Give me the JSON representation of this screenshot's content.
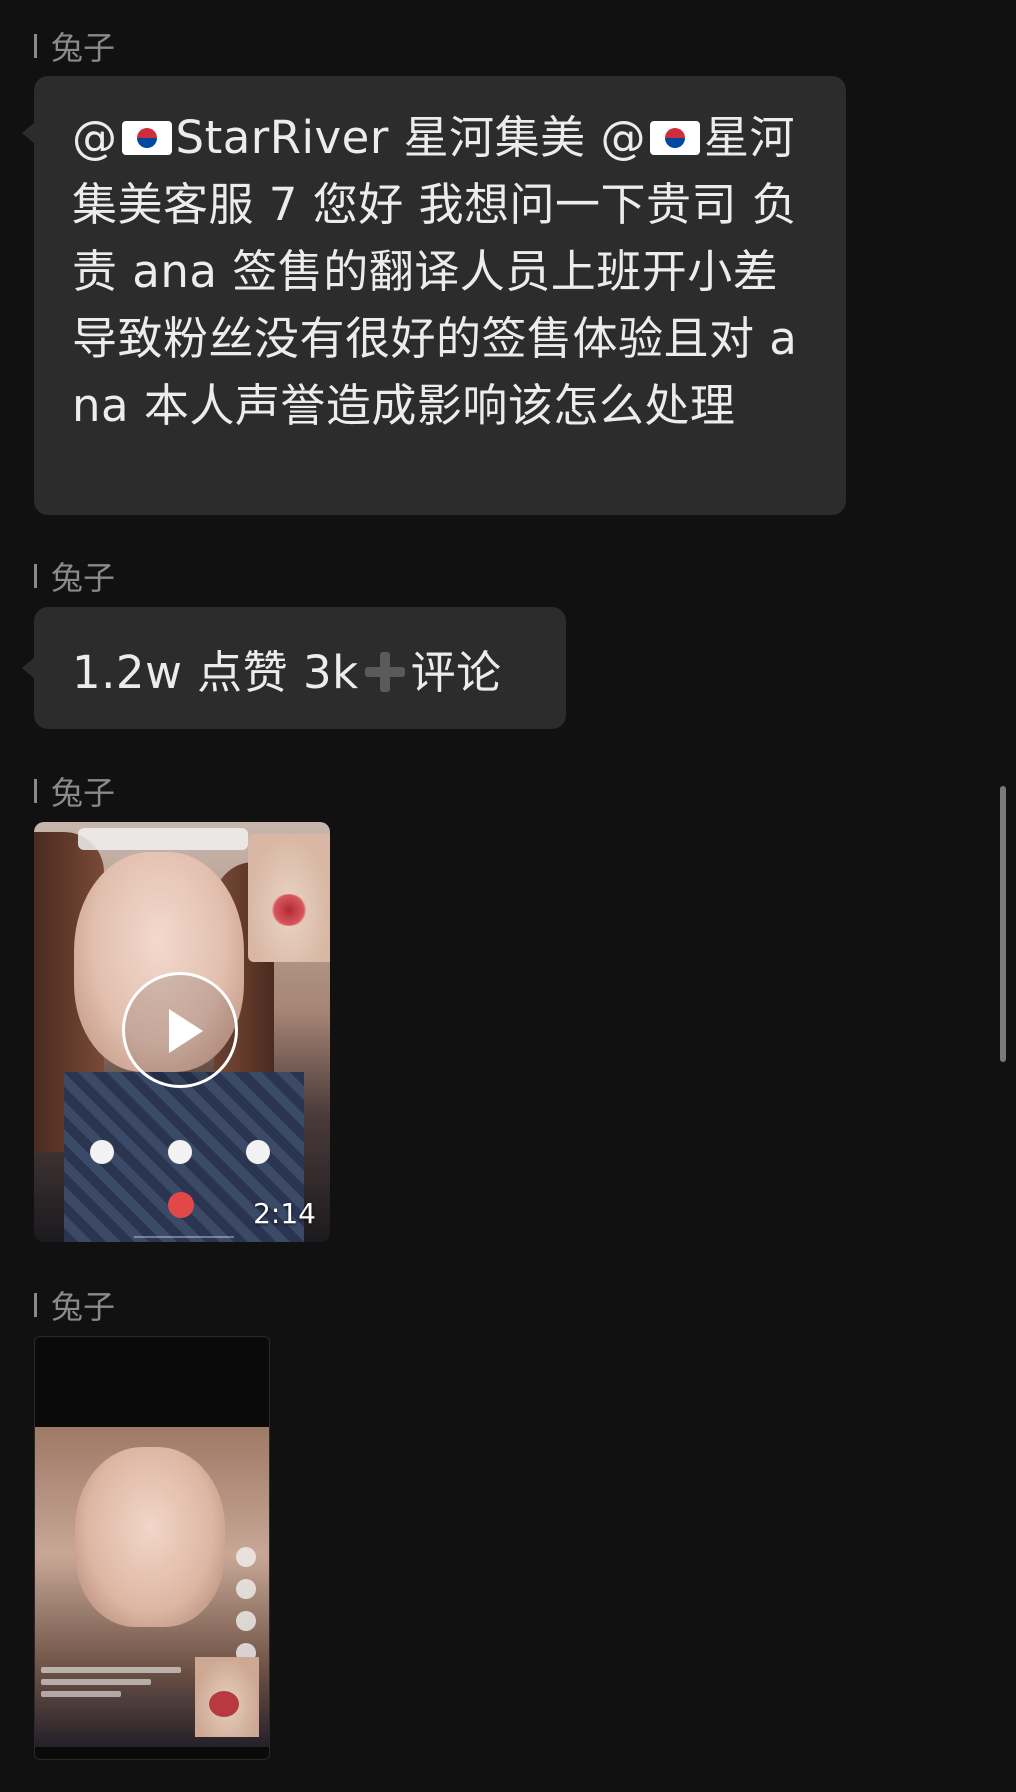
{
  "colors": {
    "background": "#111111",
    "bubble": "#2c2c2c",
    "text": "#ececec",
    "sender": "#8a8a8a"
  },
  "messages": [
    {
      "sender": "兔子",
      "type": "text",
      "parts": {
        "at1": "@",
        "name1": "StarRiver 星河集美 ",
        "at2": "@",
        "body": "星河集美客服 7 您好 我想问一下贵司 负责 ana 签售的翻译人员上班开小差导致粉丝没有很好的签售体验且对 ana 本人声誉造成影响该怎么处理"
      }
    },
    {
      "sender": "兔子",
      "type": "text",
      "parts": {
        "before": "1.2w 点赞 3k",
        "after": "评论"
      }
    },
    {
      "sender": "兔子",
      "type": "video",
      "duration": "2:14"
    },
    {
      "sender": "兔子",
      "type": "image"
    }
  ],
  "icons": {
    "flag": "south-korea-flag-icon",
    "plus": "heavy-plus-icon",
    "play": "play-icon"
  }
}
